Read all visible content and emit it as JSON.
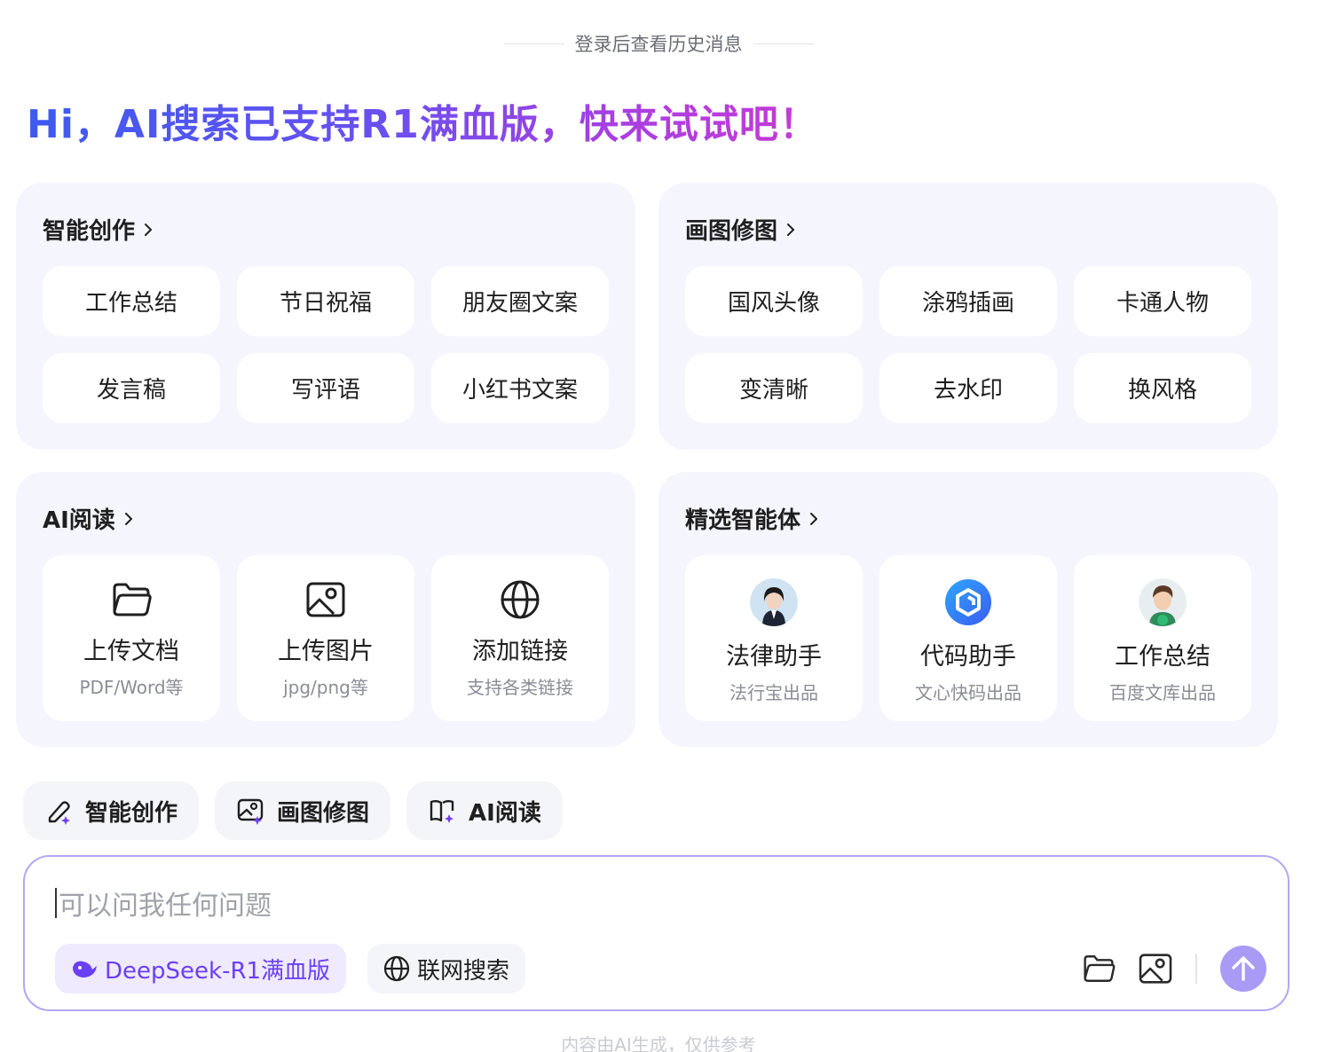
{
  "history_hint": "登录后查看历史消息",
  "headline": "Hi，AI搜索已支持R1满血版，快来试试吧！",
  "cards": {
    "creation": {
      "title": "智能创作",
      "items": [
        "工作总结",
        "节日祝福",
        "朋友圈文案",
        "发言稿",
        "写评语",
        "小红书文案"
      ]
    },
    "drawing": {
      "title": "画图修图",
      "items": [
        "国风头像",
        "涂鸦插画",
        "卡通人物",
        "变清晰",
        "去水印",
        "换风格"
      ]
    },
    "reading": {
      "title": "AI阅读",
      "items": [
        {
          "label": "上传文档",
          "sub": "PDF/Word等",
          "icon": "folder-icon"
        },
        {
          "label": "上传图片",
          "sub": "jpg/png等",
          "icon": "image-icon"
        },
        {
          "label": "添加链接",
          "sub": "支持各类链接",
          "icon": "globe-icon"
        }
      ]
    },
    "agents": {
      "title": "精选智能体",
      "items": [
        {
          "label": "法律助手",
          "sub": "法行宝出品",
          "icon": "lawyer-avatar"
        },
        {
          "label": "代码助手",
          "sub": "文心快码出品",
          "icon": "code-logo"
        },
        {
          "label": "工作总结",
          "sub": "百度文库出品",
          "icon": "cartoon-avatar"
        }
      ]
    }
  },
  "tools": [
    {
      "label": "智能创作",
      "icon": "pen-sparkle-icon"
    },
    {
      "label": "画图修图",
      "icon": "image-sparkle-icon"
    },
    {
      "label": "AI阅读",
      "icon": "book-sparkle-icon"
    }
  ],
  "composer": {
    "placeholder": "可以问我任何问题",
    "model_chip": "DeepSeek-R1满血版",
    "web_chip": "联网搜索"
  },
  "disclaimer": "内容由AI生成，仅供参考",
  "colors": {
    "accent": "#6b3ff5",
    "card_bg": "#f5f6fd",
    "send_button": "#a89af5",
    "composer_border": "#b5a6f5"
  }
}
